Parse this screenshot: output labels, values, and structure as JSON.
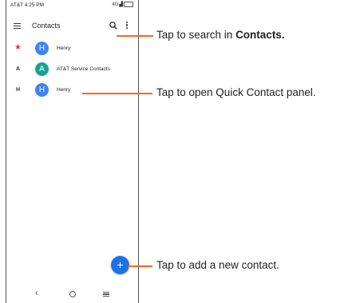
{
  "status_bar": {
    "carrier_time": "AT&T 4:25 PM",
    "network": "4G"
  },
  "app_bar": {
    "title": "Contacts"
  },
  "contacts": [
    {
      "index": "★",
      "initial": "H",
      "name": "Henry",
      "avatar_color": "#3f82f7"
    },
    {
      "index": "A",
      "initial": "A",
      "name": "AT&T Service Contacts",
      "avatar_color": "#1aa291"
    },
    {
      "index": "H",
      "initial": "H",
      "name": "Henry",
      "avatar_color": "#3f82f7"
    }
  ],
  "fab": {
    "label": "+"
  },
  "callouts": {
    "search_prefix": "Tap to search in ",
    "search_bold": "Contacts.",
    "quick_contact": "Tap to open Quick Contact panel.",
    "add_contact": "Tap to add a new contact."
  },
  "colors": {
    "accent": "#f26a21",
    "fab": "#1a73e8",
    "star": "#e53935"
  }
}
